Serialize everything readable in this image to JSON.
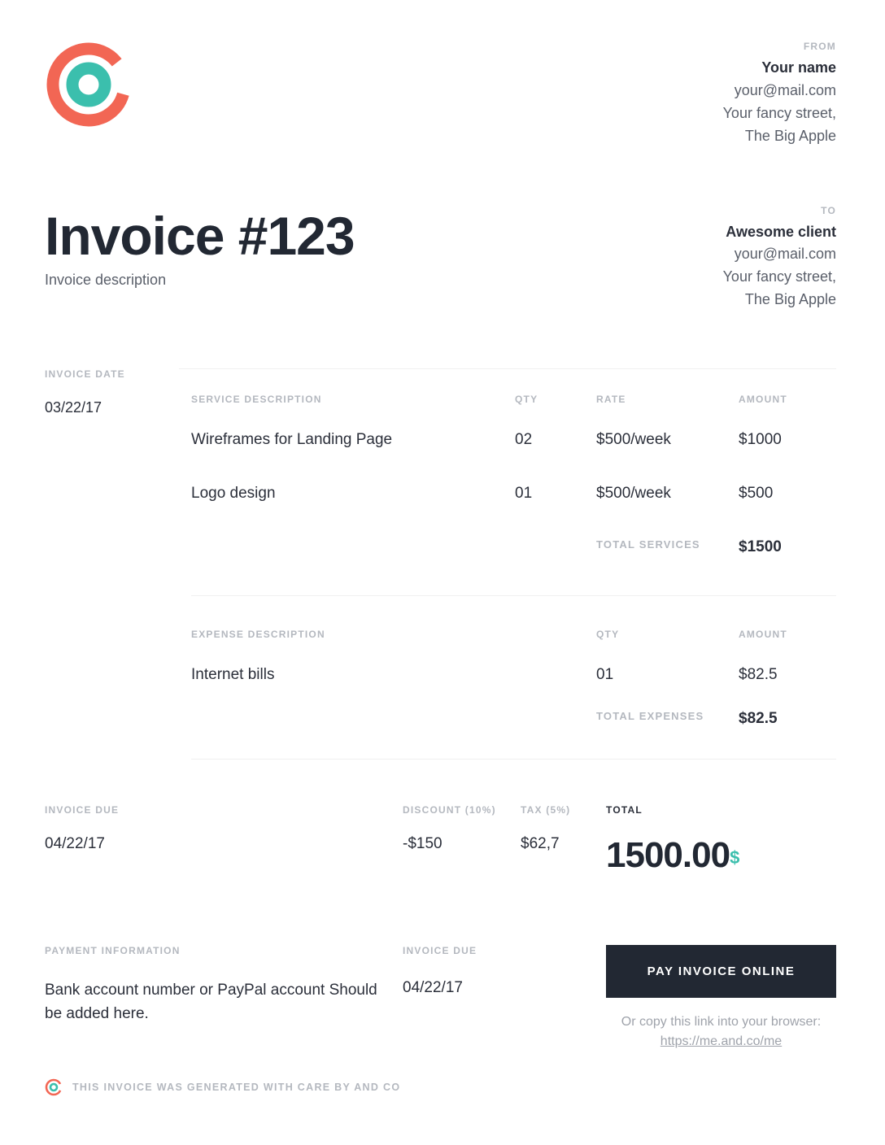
{
  "from": {
    "label": "FROM",
    "name": "Your name",
    "email": "your@mail.com",
    "street": "Your fancy street,",
    "city": "The Big Apple"
  },
  "to": {
    "label": "TO",
    "name": "Awesome client",
    "email": "your@mail.com",
    "street": "Your fancy street,",
    "city": "The Big Apple"
  },
  "invoice": {
    "title": "Invoice #123",
    "description": "Invoice description",
    "date_label": "INVOICE DATE",
    "date": "03/22/17"
  },
  "services": {
    "header": {
      "desc": "SERVICE DESCRIPTION",
      "qty": "QTY",
      "rate": "RATE",
      "amount": "AMOUNT"
    },
    "rows": [
      {
        "desc": "Wireframes for Landing Page",
        "qty": "02",
        "rate": "$500/week",
        "amount": "$1000"
      },
      {
        "desc": "Logo design",
        "qty": "01",
        "rate": "$500/week",
        "amount": "$500"
      }
    ],
    "total_label": "TOTAL SERVICES",
    "total": "$1500"
  },
  "expenses": {
    "header": {
      "desc": "EXPENSE DESCRIPTION",
      "qty": "QTY",
      "amount": "AMOUNT"
    },
    "rows": [
      {
        "desc": "Internet bills",
        "qty": "01",
        "amount": "$82.5"
      }
    ],
    "total_label": "TOTAL EXPENSES",
    "total": "$82.5"
  },
  "summary": {
    "due_label": "INVOICE DUE",
    "due": "04/22/17",
    "discount_label": "DISCOUNT (10%)",
    "discount": "-$150",
    "tax_label": "TAX (5%)",
    "tax": "$62,7",
    "total_label": "TOTAL",
    "total": "1500.00",
    "currency": "$"
  },
  "payment": {
    "info_label": "PAYMENT INFORMATION",
    "info_text": "Bank account number or PayPal account Should be added here.",
    "due_label": "INVOICE DUE",
    "due": "04/22/17",
    "button": "PAY INVOICE ONLINE",
    "copy_prefix": "Or copy this link into your browser: ",
    "copy_link": "https://me.and.co/me"
  },
  "footer": {
    "text": "THIS INVOICE WAS GENERATED WITH CARE BY AND CO"
  },
  "colors": {
    "accent_coral": "#f26654",
    "accent_teal": "#3bbfad",
    "dark": "#222833"
  }
}
